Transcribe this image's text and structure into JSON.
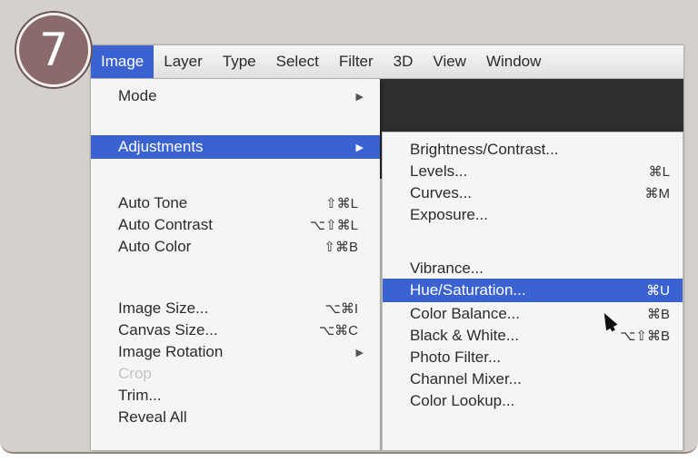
{
  "step": {
    "number": "7"
  },
  "menubar": {
    "items": [
      {
        "label": "Image",
        "active": true
      },
      {
        "label": "Layer"
      },
      {
        "label": "Type"
      },
      {
        "label": "Select"
      },
      {
        "label": "Filter"
      },
      {
        "label": "3D"
      },
      {
        "label": "View"
      },
      {
        "label": "Window"
      }
    ]
  },
  "image_menu": {
    "items": [
      {
        "label": "Mode",
        "submenu": true
      },
      {
        "label": "Adjustments",
        "submenu": true,
        "highlighted": true
      },
      {
        "label": "Auto Tone",
        "shortcut": "⇧⌘L"
      },
      {
        "label": "Auto Contrast",
        "shortcut": "⌥⇧⌘L"
      },
      {
        "label": "Auto Color",
        "shortcut": "⇧⌘B"
      },
      {
        "label": "Image Size...",
        "shortcut": "⌥⌘I"
      },
      {
        "label": "Canvas Size...",
        "shortcut": "⌥⌘C"
      },
      {
        "label": "Image Rotation",
        "submenu": true
      },
      {
        "label": "Crop",
        "disabled": true
      },
      {
        "label": "Trim..."
      },
      {
        "label": "Reveal All"
      }
    ]
  },
  "adjustments_menu": {
    "items": [
      {
        "label": "Brightness/Contrast..."
      },
      {
        "label": "Levels...",
        "shortcut": "⌘L"
      },
      {
        "label": "Curves...",
        "shortcut": "⌘M"
      },
      {
        "label": "Exposure..."
      },
      {
        "label": "Vibrance..."
      },
      {
        "label": "Hue/Saturation...",
        "shortcut": "⌘U",
        "highlighted": true
      },
      {
        "label": "Color Balance...",
        "shortcut": "⌘B"
      },
      {
        "label": "Black & White...",
        "shortcut": "⌥⇧⌘B"
      },
      {
        "label": "Photo Filter..."
      },
      {
        "label": "Channel Mixer..."
      },
      {
        "label": "Color Lookup..."
      }
    ]
  },
  "colors": {
    "highlight": "#3a63d1",
    "badge": "#8a6a6a",
    "panel": "#d4d0cb"
  }
}
